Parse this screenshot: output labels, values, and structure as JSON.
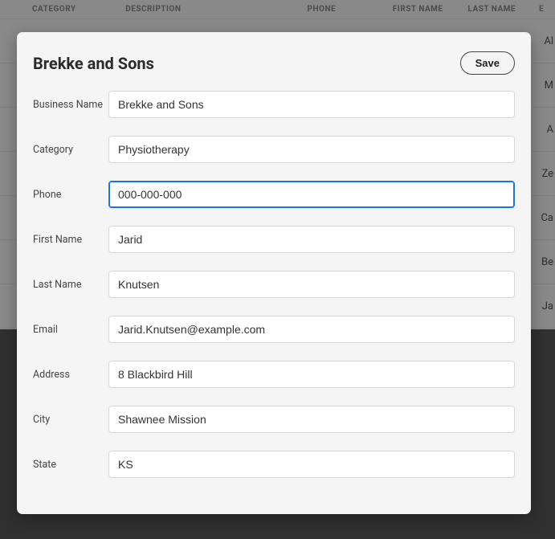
{
  "background": {
    "headers": {
      "category": "CATEGORY",
      "description": "DESCRIPTION",
      "phone": "PHONE",
      "first_name": "FIRST NAME",
      "last_name": "LAST NAME",
      "email_abbrev": "E"
    },
    "rows": [
      "Al",
      "M",
      "A",
      "Ze",
      "Ca",
      "Be",
      "Ja"
    ]
  },
  "dialog": {
    "title": "Brekke and Sons",
    "save_label": "Save",
    "fields": {
      "business_name": {
        "label": "Business Name",
        "value": "Brekke and Sons"
      },
      "category": {
        "label": "Category",
        "value": "Physiotherapy"
      },
      "phone": {
        "label": "Phone",
        "value": "000-000-000"
      },
      "first_name": {
        "label": "First Name",
        "value": "Jarid"
      },
      "last_name": {
        "label": "Last Name",
        "value": "Knutsen"
      },
      "email": {
        "label": "Email",
        "value": "Jarid.Knutsen@example.com"
      },
      "address": {
        "label": "Address",
        "value": "8 Blackbird Hill"
      },
      "city": {
        "label": "City",
        "value": "Shawnee Mission"
      },
      "state": {
        "label": "State",
        "value": "KS"
      }
    }
  }
}
